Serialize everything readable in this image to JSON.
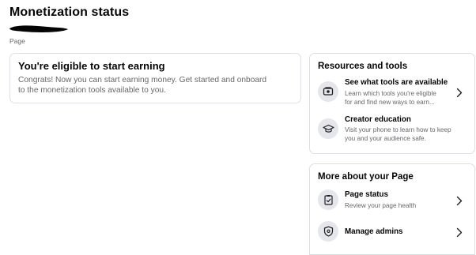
{
  "header": {
    "title": "Monetization status",
    "page_type": "Page"
  },
  "eligible_card": {
    "title": "You're eligible to start earning",
    "text_line1": "Congrats! Now you can start earning money. Get started and onboard",
    "text_line2": "to the monetization tools available to you."
  },
  "resources": {
    "heading": "Resources and tools",
    "items": [
      {
        "title": "See what tools are available",
        "desc_line1": "Learn which tools you're eligible",
        "desc_line2": "for and find new ways to earn...",
        "icon": "tools-icon",
        "has_chevron": true
      },
      {
        "title": "Creator education",
        "desc_line1": "Visit your phone to learn how to keep",
        "desc_line2": "you and your audience safe.",
        "icon": "graduation-cap-icon",
        "has_chevron": false
      }
    ]
  },
  "more_about": {
    "heading": "More about your Page",
    "items": [
      {
        "title": "Page status",
        "desc": "Review your page health",
        "icon": "clipboard-check-icon",
        "has_chevron": true
      },
      {
        "title": "Manage admins",
        "icon": "shield-icon",
        "has_chevron": true
      }
    ]
  },
  "colors": {
    "card_border": "#dcdfe3",
    "icon_bg": "#e4e6eb",
    "secondary_text": "#65676b",
    "primary_text": "#050505"
  }
}
